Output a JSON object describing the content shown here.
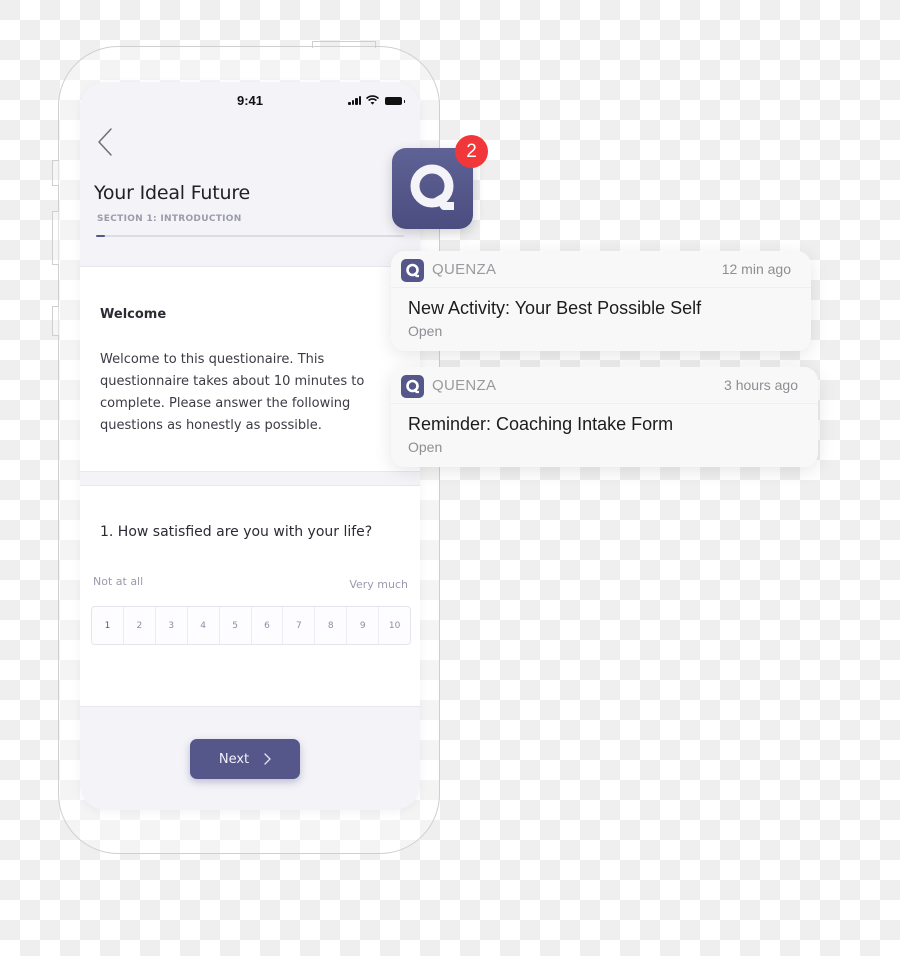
{
  "status_bar": {
    "time": "9:41",
    "icons": [
      "signal-icon",
      "wifi-icon",
      "battery-icon"
    ]
  },
  "header": {
    "back_icon": "chevron-left-icon",
    "title": "Your Ideal Future",
    "section": "SECTION 1: INTRODUCTION",
    "progress_percent": 3
  },
  "welcome": {
    "heading": "Welcome",
    "body": "Welcome to this questionaire. This questionnaire takes about 10 minutes to complete. Please answer the following questions as honestly as possible."
  },
  "question": {
    "text": "1. How satisfied are you with your life?",
    "min_label": "Not at all",
    "max_label": "Very much",
    "options": [
      "1",
      "2",
      "3",
      "4",
      "5",
      "6",
      "7",
      "8",
      "9",
      "10"
    ]
  },
  "footer": {
    "next_label": "Next",
    "next_icon": "chevron-right-icon"
  },
  "app_icon": {
    "name": "quenza-app-icon",
    "badge_count": "2"
  },
  "notifications": [
    {
      "app": "QUENZA",
      "time": "12 min ago",
      "title": "New Activity: Your Best Possible Self",
      "action": "Open"
    },
    {
      "app": "QUENZA",
      "time": "3 hours ago",
      "title": "Reminder: Coaching Intake Form",
      "action": "Open"
    }
  ],
  "colors": {
    "accent": "#55578a",
    "badge": "#f2373b",
    "screen_bg": "#f3f3f8"
  }
}
